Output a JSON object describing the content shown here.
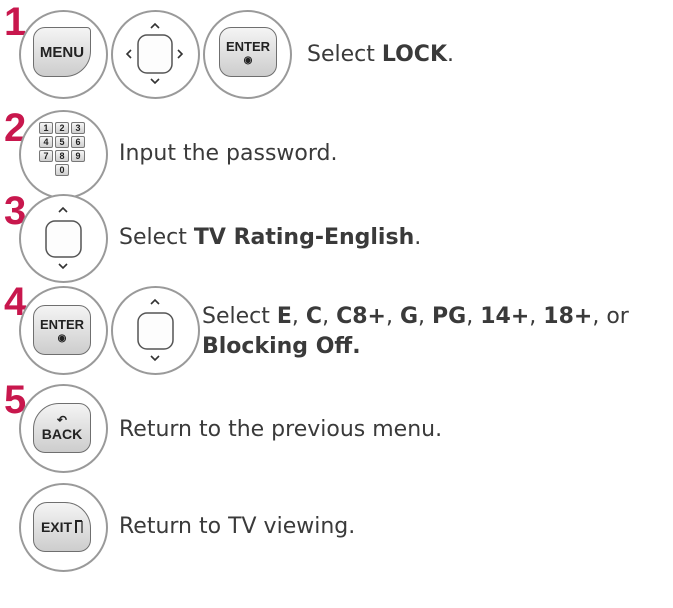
{
  "steps": [
    {
      "number": "1",
      "keys": {
        "menu": "MENU",
        "enter": "ENTER"
      },
      "text": {
        "pre": "Select ",
        "bold": "LOCK",
        "post": "."
      }
    },
    {
      "number": "2",
      "keys": {
        "numpad": [
          "1",
          "2",
          "3",
          "4",
          "5",
          "6",
          "7",
          "8",
          "9",
          "0"
        ]
      },
      "text": {
        "plain": "Input the password."
      }
    },
    {
      "number": "3",
      "keys": {},
      "text": {
        "pre": "Select ",
        "bold": "TV Rating-English",
        "post": "."
      }
    },
    {
      "number": "4",
      "keys": {
        "enter": "ENTER"
      },
      "text": {
        "line1": {
          "pre": "Select ",
          "parts": [
            "E",
            ", ",
            "C",
            ", ",
            "C8+",
            ", ",
            "G",
            ", ",
            "PG",
            ", ",
            "14+",
            ", ",
            "18+",
            ", or"
          ]
        },
        "line2_bold": "Blocking Off."
      }
    },
    {
      "number": "5",
      "keys": {
        "back": "BACK"
      },
      "text": {
        "plain": "Return to the previous menu."
      }
    },
    {
      "number": "",
      "keys": {
        "exit": "EXIT"
      },
      "text": {
        "plain": "Return to TV viewing."
      }
    }
  ],
  "colors": {
    "step_number": "#c8174d",
    "text": "#3a3a3a",
    "circle_border": "#9a9a9a"
  }
}
